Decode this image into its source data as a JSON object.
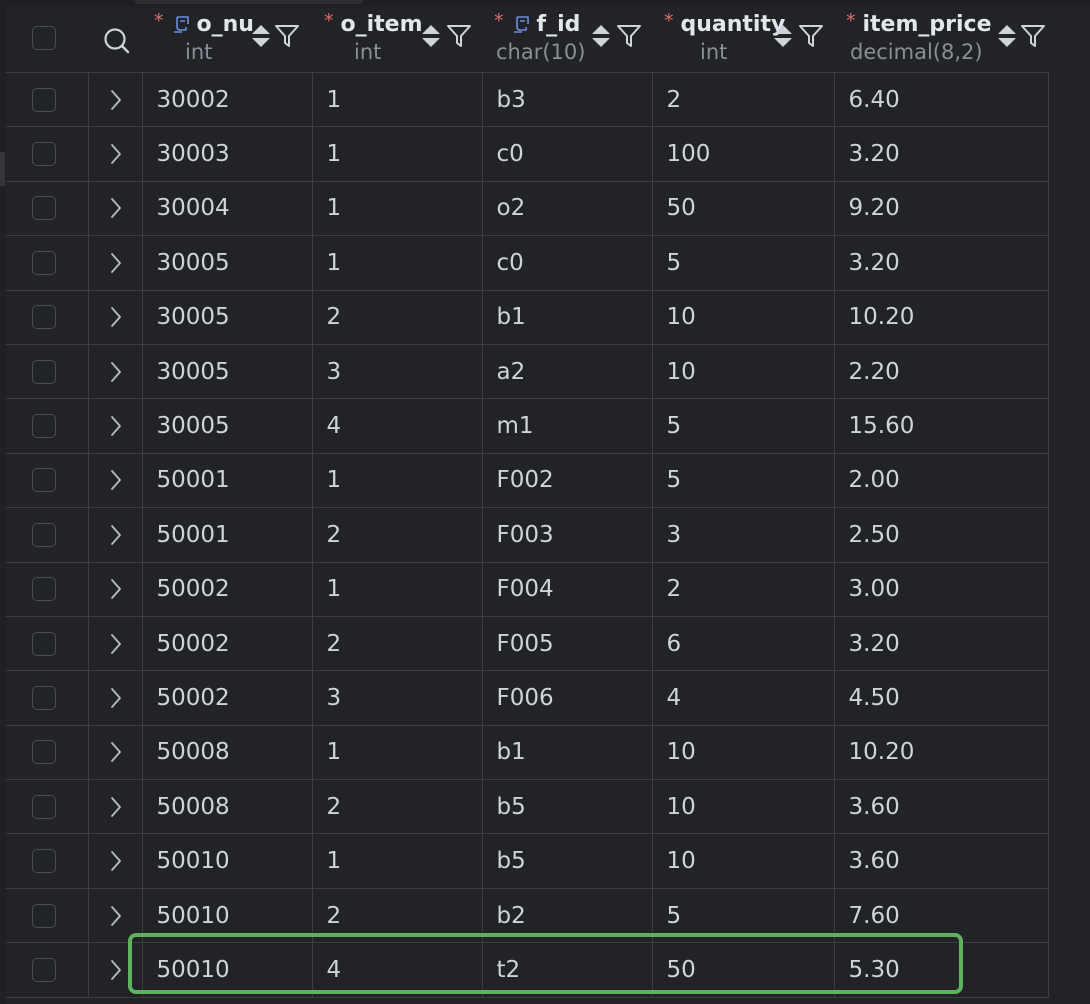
{
  "table": {
    "columns": [
      {
        "name": "o_nu",
        "type": "int",
        "required": "*",
        "key_icon": "key-icon"
      },
      {
        "name": "o_item",
        "type": "int",
        "required": "*",
        "key_icon": ""
      },
      {
        "name": "f_id",
        "type": "char(10)",
        "required": "*",
        "key_icon": "key-icon"
      },
      {
        "name": "quantity",
        "type": "int",
        "required": "*",
        "key_icon": ""
      },
      {
        "name": "item_price",
        "type": "decimal(8,2)",
        "required": "*",
        "key_icon": ""
      }
    ],
    "rows": [
      [
        "30002",
        "1",
        "b3",
        "2",
        "6.40"
      ],
      [
        "30003",
        "1",
        "c0",
        "100",
        "3.20"
      ],
      [
        "30004",
        "1",
        "o2",
        "50",
        "9.20"
      ],
      [
        "30005",
        "1",
        "c0",
        "5",
        "3.20"
      ],
      [
        "30005",
        "2",
        "b1",
        "10",
        "10.20"
      ],
      [
        "30005",
        "3",
        "a2",
        "10",
        "2.20"
      ],
      [
        "30005",
        "4",
        "m1",
        "5",
        "15.60"
      ],
      [
        "50001",
        "1",
        "F002",
        "5",
        "2.00"
      ],
      [
        "50001",
        "2",
        "F003",
        "3",
        "2.50"
      ],
      [
        "50002",
        "1",
        "F004",
        "2",
        "3.00"
      ],
      [
        "50002",
        "2",
        "F005",
        "6",
        "3.20"
      ],
      [
        "50002",
        "3",
        "F006",
        "4",
        "4.50"
      ],
      [
        "50008",
        "1",
        "b1",
        "10",
        "10.20"
      ],
      [
        "50008",
        "2",
        "b5",
        "10",
        "3.60"
      ],
      [
        "50010",
        "1",
        "b5",
        "10",
        "3.60"
      ],
      [
        "50010",
        "2",
        "b2",
        "5",
        "7.60"
      ],
      [
        "50010",
        "4",
        "t2",
        "50",
        "5.30"
      ]
    ],
    "highlighted_row": 16
  },
  "colors": {
    "background": "#222327",
    "grid_line": "#3c3e44",
    "required_star": "#e06b6b",
    "key_icon": "#6d8fe0",
    "highlight": "#5fb35f"
  },
  "icons": {
    "search": "search-icon",
    "sort": "sort-icon",
    "filter": "filter-icon",
    "expand": "chevron-right-icon",
    "checkbox": "checkbox-icon"
  }
}
